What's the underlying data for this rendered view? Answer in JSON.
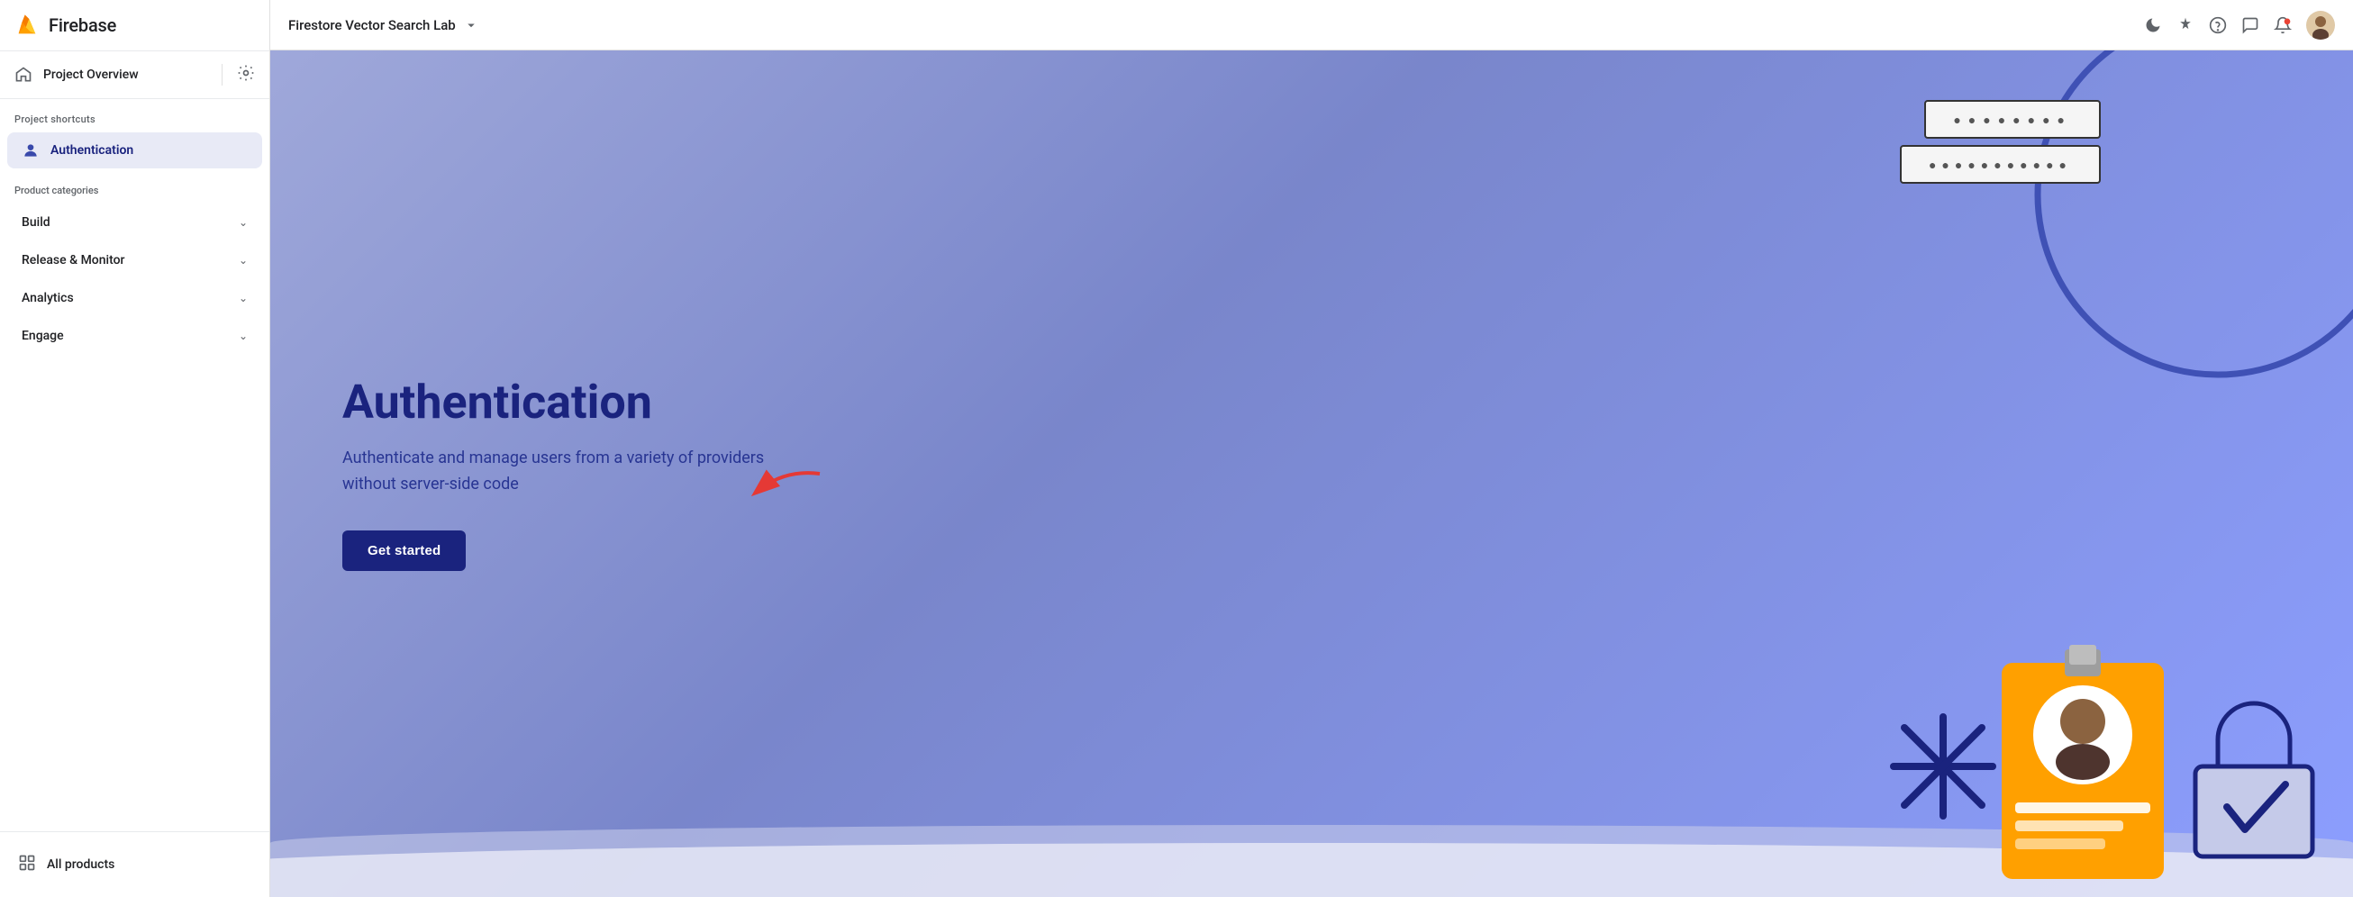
{
  "app": {
    "name": "Firebase"
  },
  "topbar": {
    "project_name": "Firestore Vector Search Lab",
    "dropdown_icon": "▾",
    "icons": {
      "moon": "🌙",
      "sparkle": "✦",
      "help": "?",
      "chat": "💬",
      "bell": "🔔"
    }
  },
  "sidebar": {
    "project_overview_label": "Project Overview",
    "section_project_shortcuts": "Project shortcuts",
    "auth_item_label": "Authentication",
    "section_product_categories": "Product categories",
    "categories": [
      {
        "label": "Build"
      },
      {
        "label": "Release & Monitor"
      },
      {
        "label": "Analytics"
      },
      {
        "label": "Engage"
      }
    ],
    "all_products_label": "All products"
  },
  "hero": {
    "title": "Authentication",
    "description": "Authenticate and manage users from a variety of providers without server-side code",
    "get_started_label": "Get started"
  }
}
